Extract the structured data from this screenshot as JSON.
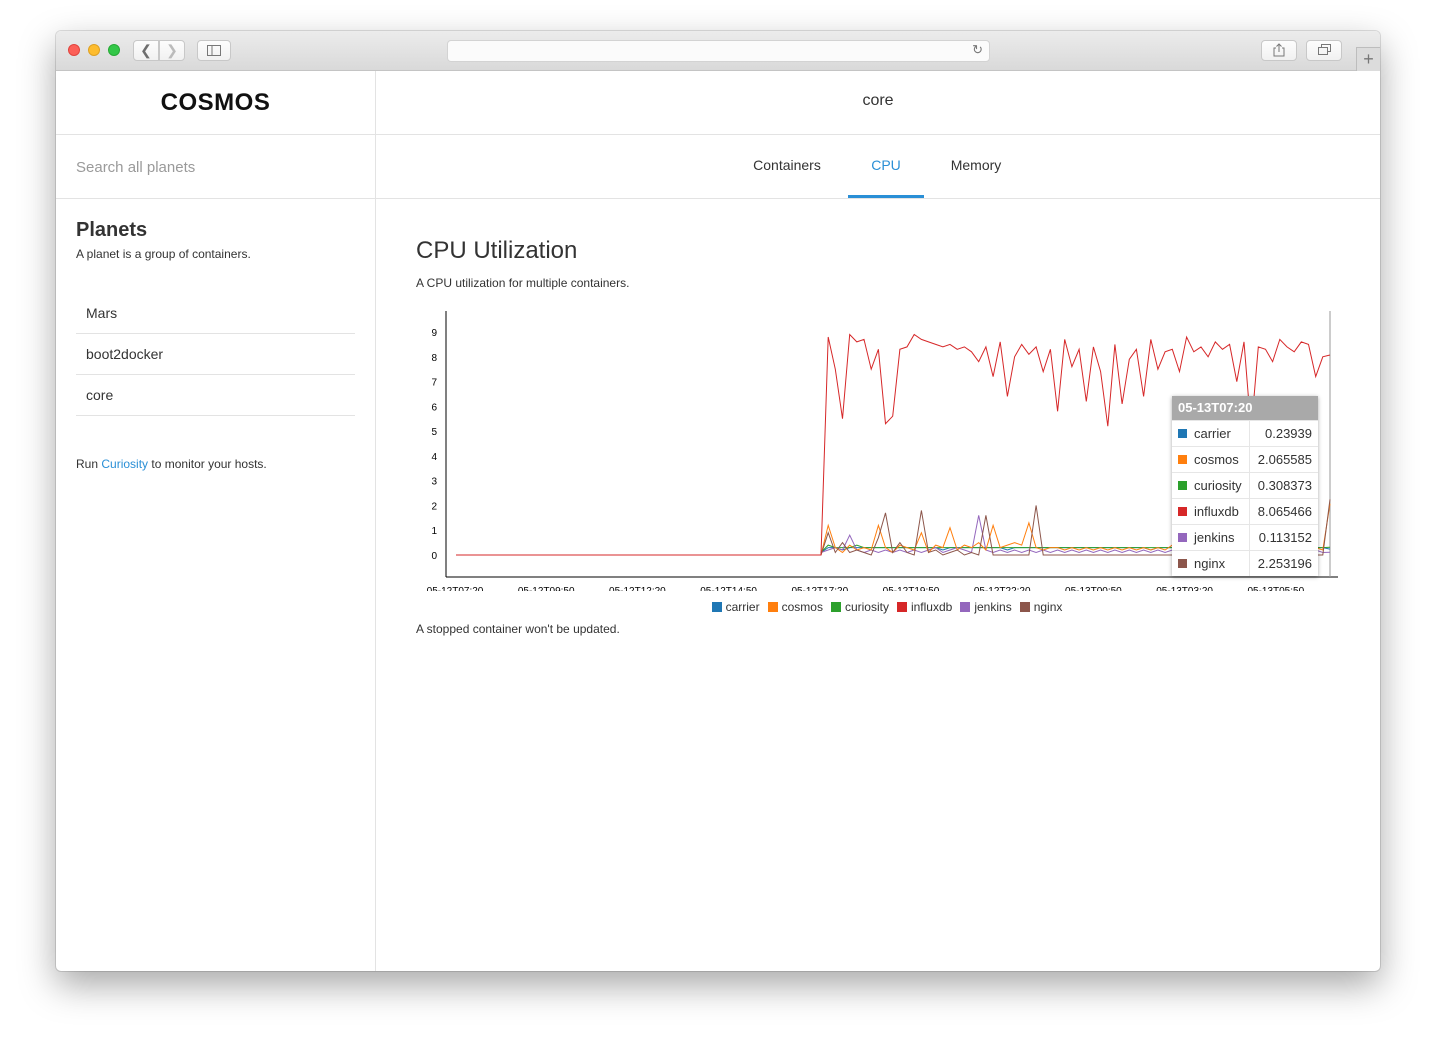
{
  "app": {
    "brand": "COSMOS",
    "current_planet": "core"
  },
  "search": {
    "placeholder": "Search all planets"
  },
  "sidebar": {
    "title": "Planets",
    "description": "A planet is a group of containers.",
    "planets": [
      "Mars",
      "boot2docker",
      "core"
    ],
    "run_prefix": "Run ",
    "run_link": "Curiosity",
    "run_suffix": " to monitor your hosts."
  },
  "tabs": [
    {
      "label": "Containers",
      "active": false
    },
    {
      "label": "CPU",
      "active": true
    },
    {
      "label": "Memory",
      "active": false
    }
  ],
  "page": {
    "title": "CPU Utilization",
    "description": "A CPU utilization for multiple containers.",
    "footnote": "A stopped container won't be updated."
  },
  "colors": {
    "accent": "#2a8fd6",
    "carrier": "#1f77b4",
    "cosmos": "#ff7f0e",
    "curiosity": "#2ca02c",
    "influxdb": "#d62728",
    "jenkins": "#9467bd",
    "nginx": "#8c564b"
  },
  "tooltip": {
    "title": "05-13T07:20",
    "rows": [
      {
        "name": "carrier",
        "value": "0.23939",
        "color": "#1f77b4"
      },
      {
        "name": "cosmos",
        "value": "2.065585",
        "color": "#ff7f0e"
      },
      {
        "name": "curiosity",
        "value": "0.308373",
        "color": "#2ca02c"
      },
      {
        "name": "influxdb",
        "value": "8.065466",
        "color": "#d62728"
      },
      {
        "name": "jenkins",
        "value": "0.113152",
        "color": "#9467bd"
      },
      {
        "name": "nginx",
        "value": "2.253196",
        "color": "#8c564b"
      }
    ]
  },
  "chart_data": {
    "type": "line",
    "title": "",
    "xlabel": "",
    "ylabel": "",
    "ylim": [
      0,
      9
    ],
    "yticks": [
      0,
      1,
      2,
      3,
      4,
      5,
      6,
      7,
      8,
      9
    ],
    "xticks": [
      "05-12T07:20",
      "05-12T09:50",
      "05-12T12:20",
      "05-12T14:50",
      "05-12T17:20",
      "05-12T19:50",
      "05-12T22:20",
      "05-13T00:50",
      "05-13T03:20",
      "05-13T05:50"
    ],
    "legend": "bottom",
    "grid": false,
    "idle_until": "05-12T17:20",
    "end": "05-13T07:20",
    "series": [
      {
        "name": "carrier",
        "color": "#1f77b4",
        "active_values": [
          0.1,
          0.3,
          0.3,
          0.2,
          0.3,
          0.3,
          0.3,
          0.3,
          0.3,
          0.3,
          0.3,
          0.3,
          0.3,
          0.3,
          0.3,
          0.3,
          0.3,
          0.2,
          0.3,
          0.3,
          0.3,
          0.3,
          0.3,
          0.3,
          0.3,
          0.3,
          0.2,
          0.3,
          0.3,
          0.3,
          0.3,
          0.3,
          0.3,
          0.3,
          0.3,
          0.3,
          0.3,
          0.3,
          0.3,
          0.3,
          0.3,
          0.3,
          0.3,
          0.3,
          0.3,
          0.3,
          0.2,
          0.3,
          0.3,
          0.3,
          0.3,
          0.3,
          0.3,
          0.3,
          0.3,
          0.3,
          0.3,
          0.3,
          0.3,
          0.3,
          0.2,
          0.3,
          0.3,
          0.3,
          0.3,
          0.3,
          0.3,
          0.3,
          0.2,
          0.3,
          0.3,
          0.24
        ]
      },
      {
        "name": "cosmos",
        "color": "#ff7f0e",
        "active_values": [
          0,
          1.2,
          0.3,
          0.1,
          0.4,
          0.2,
          0.3,
          0.2,
          1.2,
          0.3,
          0.1,
          0.4,
          0.3,
          0.2,
          0.9,
          0.1,
          0.4,
          0.3,
          1.1,
          0.2,
          0.4,
          0.3,
          0.5,
          0.2,
          1.2,
          0.3,
          0.4,
          0.5,
          0.4,
          1.3,
          0.3,
          0.2,
          0.3,
          0.3,
          0.2,
          0.3,
          0.2,
          0.3,
          0.2,
          0.3,
          0.2,
          0.3,
          0.2,
          0.3,
          0.2,
          0.3,
          0.2,
          0.3,
          0.2,
          0.4,
          0.2,
          0.3,
          0.2,
          0.3,
          0.2,
          0.3,
          0.2,
          0.3,
          0.2,
          0.3,
          0.2,
          0.3,
          0.2,
          0.3,
          0.2,
          0.3,
          0.2,
          0.3,
          0.2,
          0.3,
          0.2,
          2.07
        ]
      },
      {
        "name": "curiosity",
        "color": "#2ca02c",
        "active_values": [
          0.1,
          0.4,
          0.3,
          0.3,
          0.3,
          0.4,
          0.3,
          0.3,
          0.3,
          0.3,
          0.3,
          0.3,
          0.3,
          0.3,
          0.3,
          0.3,
          0.3,
          0.3,
          0.3,
          0.3,
          0.3,
          0.3,
          0.3,
          0.3,
          0.3,
          0.3,
          0.3,
          0.3,
          0.3,
          0.3,
          0.3,
          0.3,
          0.3,
          0.3,
          0.3,
          0.3,
          0.3,
          0.3,
          0.3,
          0.3,
          0.3,
          0.3,
          0.3,
          0.3,
          0.3,
          0.3,
          0.3,
          0.3,
          0.3,
          0.3,
          0.3,
          0.3,
          0.3,
          0.3,
          0.3,
          0.3,
          0.3,
          0.3,
          0.3,
          0.3,
          0.3,
          0.3,
          0.3,
          0.3,
          0.3,
          0.3,
          0.3,
          0.3,
          0.3,
          0.3,
          0.3,
          0.31
        ]
      },
      {
        "name": "influxdb",
        "color": "#d62728",
        "active_values": [
          0,
          8.8,
          7.5,
          5.5,
          8.9,
          8.6,
          8.7,
          7.5,
          8.3,
          5.3,
          5.6,
          8.3,
          8.4,
          8.9,
          8.7,
          8.6,
          8.5,
          8.4,
          8.5,
          8.3,
          8.4,
          8.2,
          7.8,
          8.4,
          7.2,
          8.6,
          6.4,
          8.0,
          8.5,
          8.1,
          8.4,
          7.4,
          8.3,
          5.8,
          8.7,
          7.6,
          8.3,
          6.2,
          8.4,
          7.4,
          5.2,
          8.5,
          6.1,
          7.9,
          8.3,
          6.4,
          8.7,
          7.5,
          8.2,
          8.3,
          7.4,
          8.8,
          8.2,
          8.4,
          8.0,
          8.6,
          8.3,
          8.5,
          7.0,
          8.6,
          5.0,
          8.4,
          8.3,
          7.8,
          8.7,
          8.4,
          8.2,
          8.6,
          8.5,
          7.2,
          8.0,
          8.07
        ]
      },
      {
        "name": "jenkins",
        "color": "#9467bd",
        "active_values": [
          0.1,
          0.2,
          0.3,
          0.2,
          0.8,
          0.2,
          0.1,
          0.2,
          0.1,
          0.2,
          0.1,
          0.2,
          0.1,
          0.2,
          0.1,
          0.2,
          0.3,
          0.1,
          0.2,
          0.3,
          0.2,
          0.1,
          1.6,
          0.2,
          0.1,
          0.2,
          0.1,
          0.2,
          0.1,
          0.2,
          0.1,
          0.2,
          0.1,
          0.2,
          0.1,
          0.2,
          0.1,
          0.2,
          0.1,
          0.2,
          0.1,
          0.2,
          0.1,
          0.2,
          0.1,
          0.2,
          0.1,
          0.2,
          0.1,
          0.2,
          0.1,
          0.2,
          0.1,
          0.2,
          0.1,
          0.2,
          0.1,
          0.2,
          0.1,
          0.2,
          0.1,
          0.2,
          0.1,
          0.7,
          0.1,
          0.2,
          0.1,
          0.2,
          0.1,
          0.2,
          0.1,
          0.11
        ]
      },
      {
        "name": "nginx",
        "color": "#8c564b",
        "active_values": [
          0,
          0.9,
          0.1,
          0.5,
          0.1,
          0.2,
          0.1,
          0.0,
          0.7,
          1.7,
          0.1,
          0.5,
          0.1,
          0.0,
          1.8,
          0.1,
          0.2,
          0.0,
          0.1,
          0.2,
          0.0,
          0.1,
          0.0,
          1.6,
          0.0,
          0.0,
          0.0,
          0.0,
          0.0,
          0.0,
          2.0,
          0.0,
          0.0,
          0.0,
          0.0,
          0.0,
          0.0,
          0.0,
          0.0,
          0.0,
          0.0,
          0.0,
          0.0,
          0.0,
          0.0,
          0.0,
          0.0,
          0.0,
          0.0,
          0.0,
          0.0,
          0.0,
          0.0,
          0.0,
          0.0,
          0.0,
          0.0,
          0.0,
          0.0,
          0.0,
          0.0,
          0.0,
          0.0,
          0.0,
          0.0,
          0.0,
          0.0,
          0.0,
          0.0,
          0.0,
          0.0,
          2.25
        ]
      }
    ]
  }
}
